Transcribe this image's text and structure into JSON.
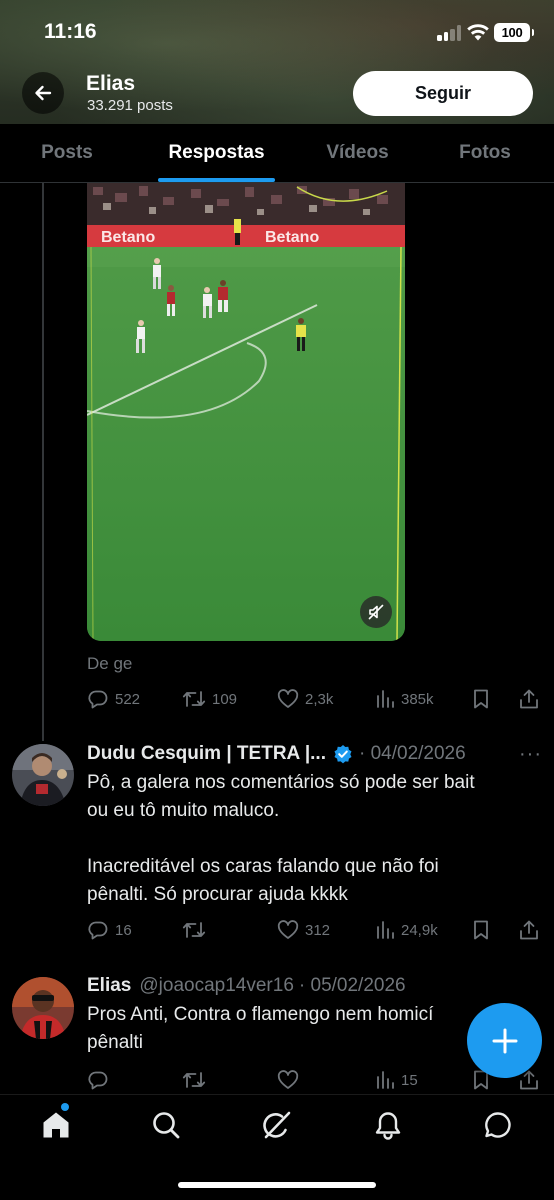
{
  "status": {
    "time": "11:16",
    "battery": "100"
  },
  "profile": {
    "name": "Elias",
    "posts_count": "33.291 posts",
    "follow_label": "Seguir"
  },
  "tabs": [
    {
      "label": "Posts",
      "active": false
    },
    {
      "label": "Respostas",
      "active": true
    },
    {
      "label": "Vídeos",
      "active": false
    },
    {
      "label": "Fotos",
      "active": false
    }
  ],
  "video_post": {
    "video_ads": [
      "Betano",
      "Betano"
    ],
    "source": "De ge",
    "replies": "522",
    "reposts": "109",
    "likes": "2,3k",
    "views": "385k"
  },
  "posts": [
    {
      "name": "Dudu Cesquim | TETRA |...",
      "verified": true,
      "handle": "",
      "date": "· 04/02/2026",
      "lines": [
        "Pô, a galera nos comentários só pode ser bait",
        "ou eu tô muito maluco.",
        "",
        "Inacreditável os caras falando que não foi",
        "pênalti. Só procurar ajuda kkkk"
      ],
      "replies": "16",
      "reposts": "",
      "likes": "312",
      "views": "24,9k"
    },
    {
      "name": "Elias",
      "verified": false,
      "handle": "@joaocap14ver16",
      "date": "· 05/02/2026",
      "lines": [
        "Pros Anti, Contra o flamengo nem homicí",
        "pênalti"
      ],
      "replies": "",
      "reposts": "",
      "likes": "",
      "views": "15"
    }
  ],
  "colors": {
    "accent": "#1d9bf0",
    "muted": "#71767b",
    "background": "#000000"
  },
  "icons": [
    "back-arrow-icon",
    "reply-icon",
    "repost-icon",
    "like-icon",
    "views-icon",
    "bookmark-icon",
    "share-icon",
    "verified-icon",
    "more-icon",
    "compose-icon",
    "home-icon",
    "search-icon",
    "grok-icon",
    "notifications-icon",
    "messages-icon",
    "mute-icon"
  ]
}
